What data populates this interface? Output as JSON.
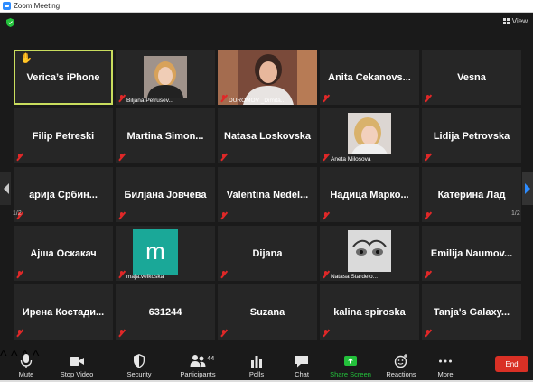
{
  "window": {
    "title": "Zoom Meeting"
  },
  "header": {
    "view_label": "View"
  },
  "colors": {
    "active_border": "#c9dd5d",
    "share_green": "#23c13b",
    "end_red": "#d93025",
    "avatar_teal": "#1aa898"
  },
  "tiles": [
    {
      "name": "Verica’s iPhone",
      "label": "",
      "type": "text",
      "raised_hand": true,
      "active": true
    },
    {
      "name": "",
      "label": "Biljana Petrusev...",
      "type": "photo"
    },
    {
      "name": "",
      "label": "DUROMOV _Dimita...",
      "type": "video"
    },
    {
      "name": "Anita Cekanovs...",
      "label": "",
      "type": "text"
    },
    {
      "name": "Vesna",
      "label": "",
      "type": "text"
    },
    {
      "name": "Filip Petreski",
      "label": "",
      "type": "text"
    },
    {
      "name": "Martina Simon...",
      "label": "",
      "type": "text"
    },
    {
      "name": "Natasa Loskovska",
      "label": "",
      "type": "text"
    },
    {
      "name": "",
      "label": "Aneta Milosova",
      "type": "photo"
    },
    {
      "name": "Lidija Petrovska",
      "label": "",
      "type": "text"
    },
    {
      "name": "арија Србин...",
      "label": "",
      "type": "text"
    },
    {
      "name": "Билјана Јовчева",
      "label": "",
      "type": "text"
    },
    {
      "name": "Valentina Nedel...",
      "label": "",
      "type": "text"
    },
    {
      "name": "Надица Марко...",
      "label": "",
      "type": "text"
    },
    {
      "name": "Катерина Лад",
      "label": "",
      "type": "text"
    },
    {
      "name": "Ајша Оскакач",
      "label": "",
      "type": "text"
    },
    {
      "name": "",
      "label": "maja.velkoska",
      "type": "avatar",
      "avatar_letter": "m"
    },
    {
      "name": "Dijana",
      "label": "",
      "type": "text"
    },
    {
      "name": "",
      "label": "Natasa Stardelo...",
      "type": "photo"
    },
    {
      "name": "Emilija Naumov...",
      "label": "",
      "type": "text"
    },
    {
      "name": "Ирена Костади...",
      "label": "",
      "type": "text"
    },
    {
      "name": "631244",
      "label": "",
      "type": "text"
    },
    {
      "name": "Suzana",
      "label": "",
      "type": "text"
    },
    {
      "name": "kalina spiroska",
      "label": "",
      "type": "text"
    },
    {
      "name": "Tanja's Galaxy...",
      "label": "",
      "type": "text"
    }
  ],
  "pagination": {
    "left": "1/2",
    "right": "1/2"
  },
  "toolbar": {
    "mute": "Mute",
    "stop_video": "Stop Video",
    "security": "Security",
    "participants": "Participants",
    "participants_count": "44",
    "polls": "Polls",
    "chat": "Chat",
    "share_screen": "Share Screen",
    "reactions": "Reactions",
    "more": "More",
    "end": "End"
  }
}
